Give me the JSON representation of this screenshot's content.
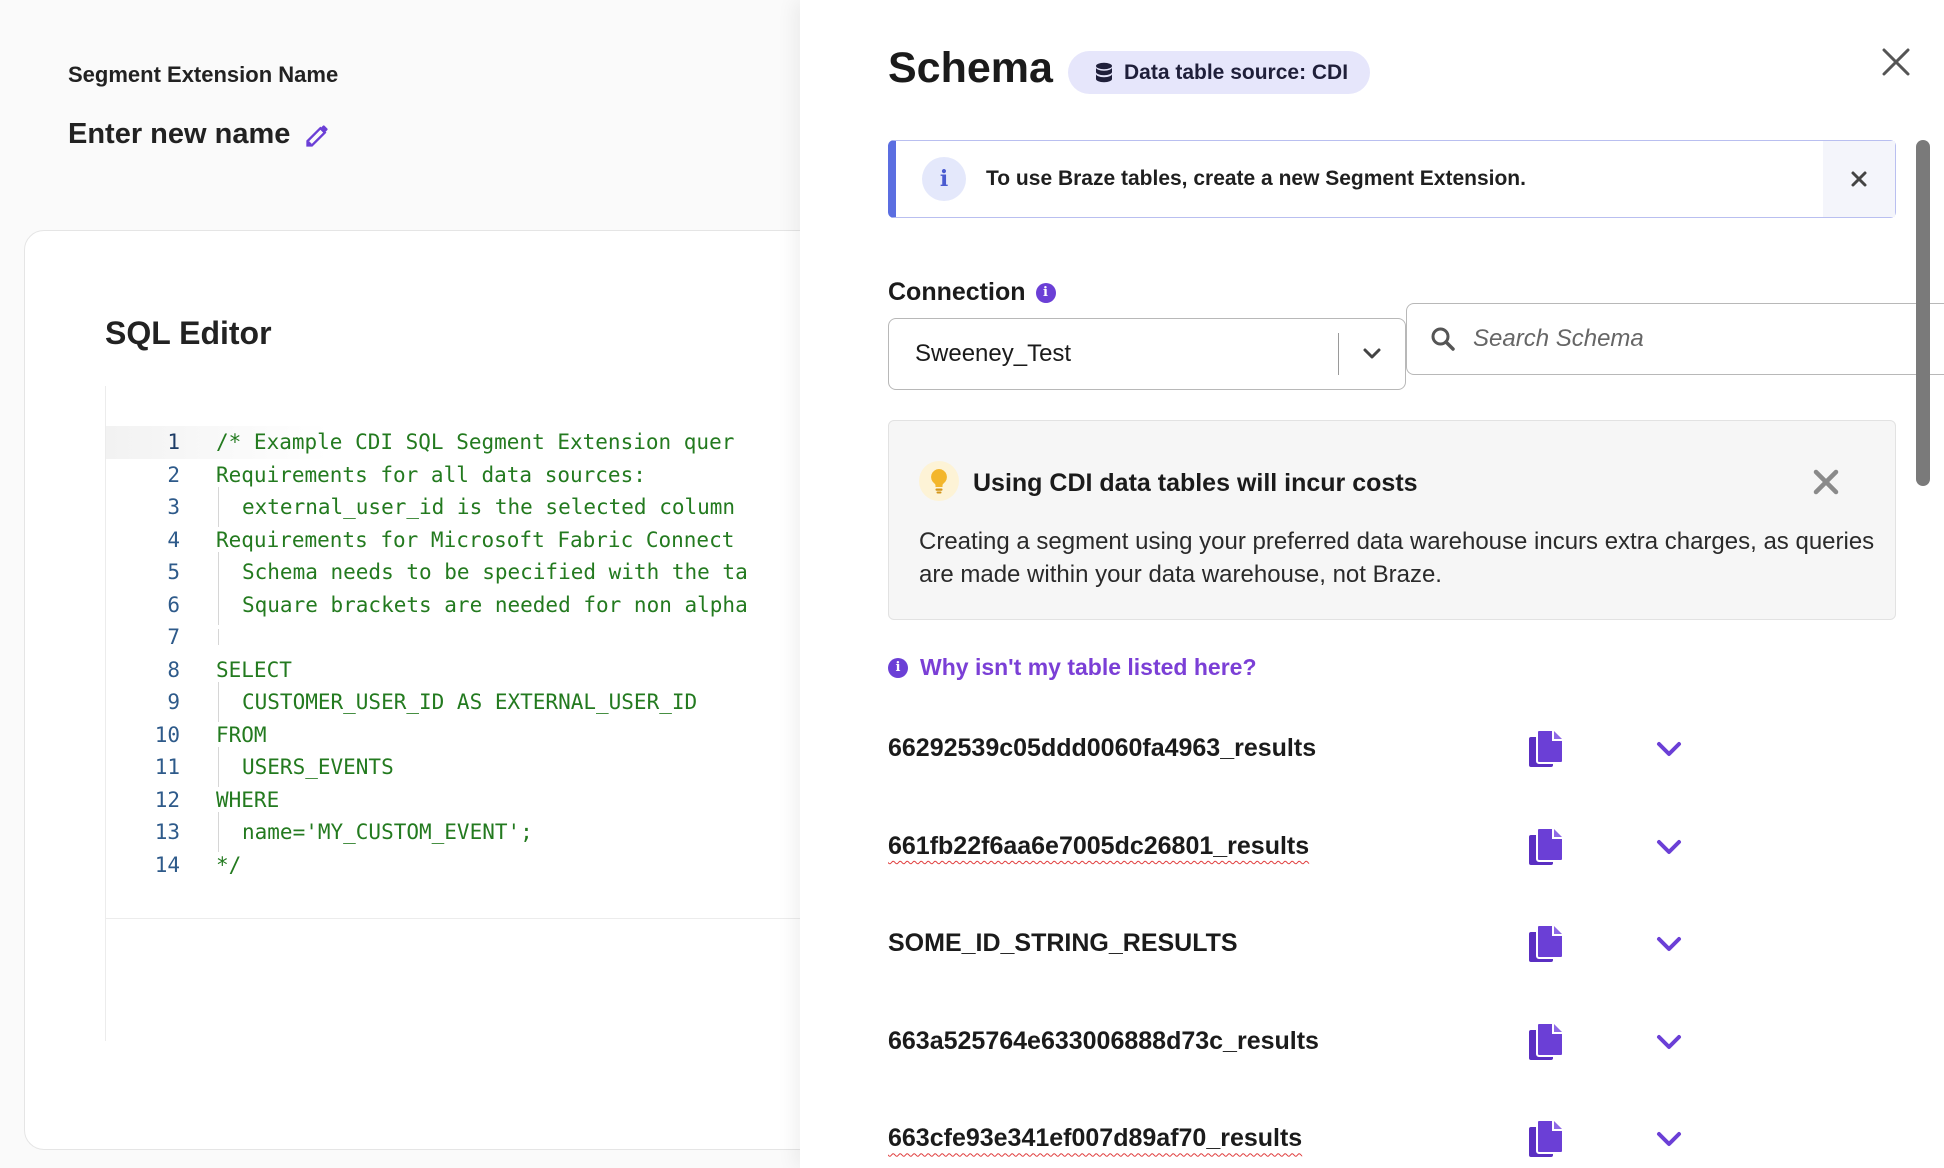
{
  "left": {
    "segment_label": "Segment Extension Name",
    "segment_name": "Enter new name",
    "editor_title": "SQL Editor",
    "code_lines": [
      {
        "n": "1",
        "text": "/* Example CDI SQL Segment Extension quer",
        "indent": false
      },
      {
        "n": "2",
        "text": "Requirements for all data sources:",
        "indent": false
      },
      {
        "n": "3",
        "text": "external_user_id is the selected column",
        "indent": true
      },
      {
        "n": "4",
        "text": "Requirements for Microsoft Fabric Connect",
        "indent": false
      },
      {
        "n": "5",
        "text": "Schema needs to be specified with the ta",
        "indent": true
      },
      {
        "n": "6",
        "text": "Square brackets are needed for non alpha",
        "indent": true
      },
      {
        "n": "7",
        "text": "",
        "indent": true
      },
      {
        "n": "8",
        "text": "SELECT",
        "indent": false
      },
      {
        "n": "9",
        "text": "CUSTOMER_USER_ID AS EXTERNAL_USER_ID",
        "indent": true
      },
      {
        "n": "10",
        "text": "FROM",
        "indent": false
      },
      {
        "n": "11",
        "text": "USERS_EVENTS",
        "indent": true
      },
      {
        "n": "12",
        "text": "WHERE",
        "indent": false
      },
      {
        "n": "13",
        "text": "name='MY_CUSTOM_EVENT';",
        "indent": true
      },
      {
        "n": "14",
        "text": "*/",
        "indent": false
      }
    ]
  },
  "panel": {
    "title": "Schema",
    "source_badge": "Data table source: CDI",
    "info_banner": "To use Braze tables, create a new Segment Extension.",
    "connection_label": "Connection",
    "connection_value": "Sweeney_Test",
    "search_placeholder": "Search Schema",
    "cost_title": "Using CDI data tables will incur costs",
    "cost_body": "Creating a segment using your preferred data warehouse incurs extra charges, as queries are made within your data warehouse, not Braze.",
    "why_link": "Why isn't my table listed here?",
    "tables": [
      {
        "name": "66292539c05ddd0060fa4963_results",
        "spell": false
      },
      {
        "name": "661fb22f6aa6e7005dc26801_results",
        "spell": true
      },
      {
        "name": "SOME_ID_STRING_RESULTS",
        "spell": false
      },
      {
        "name": "663a525764e633006888d73c_results",
        "spell": false
      },
      {
        "name": "663cfe93e341ef007d89af70_results",
        "spell": true
      }
    ]
  },
  "colors": {
    "accent": "#6b3fd6",
    "banner_border": "#5b6ee1",
    "code_green": "#237a1f",
    "line_number": "#2e5a8a"
  }
}
